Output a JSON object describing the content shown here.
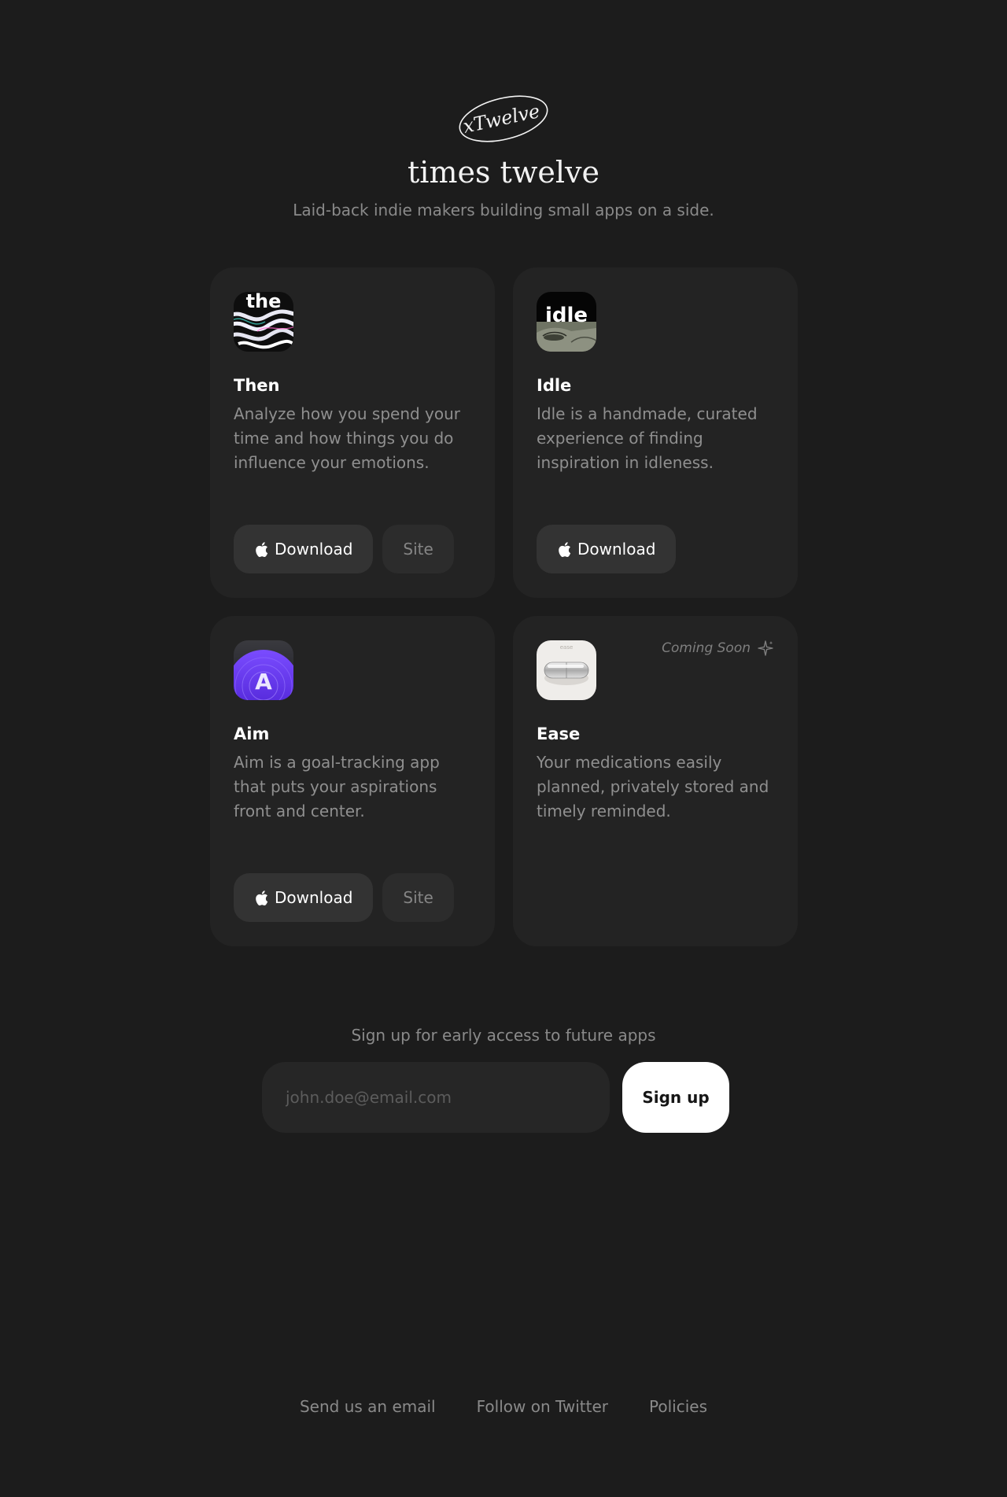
{
  "header": {
    "logo_text": "xTwelve",
    "title": "times twelve",
    "tagline": "Laid-back indie makers building small apps on a side."
  },
  "apps": [
    {
      "name": "Then",
      "icon": "then-app-icon",
      "icon_text": "the",
      "description": "Analyze how you spend your time and how things you do influence your emotions.",
      "download_label": "Download",
      "site_label": "Site"
    },
    {
      "name": "Idle",
      "icon": "idle-app-icon",
      "icon_text": "idle",
      "description": "Idle is a handmade, curated experience of finding inspiration in idleness.",
      "download_label": "Download"
    },
    {
      "name": "Aim",
      "icon": "aim-app-icon",
      "icon_text": "A",
      "description": "Aim is a goal-tracking app that puts your aspirations front and center.",
      "download_label": "Download",
      "site_label": "Site"
    },
    {
      "name": "Ease",
      "icon": "ease-app-icon",
      "icon_text": "ease",
      "description": "Your medications easily planned, privately stored and timely reminded.",
      "badge": "Coming Soon"
    }
  ],
  "signup": {
    "prompt": "Sign up for early access to future apps",
    "placeholder": "john.doe@email.com",
    "button_label": "Sign up"
  },
  "footer": {
    "links": [
      "Send us an email",
      "Follow on Twitter",
      "Policies"
    ]
  },
  "colors": {
    "background": "#1c1c1c",
    "card": "#232323",
    "button": "#333333",
    "muted_text": "#8a8a8a",
    "aim_purple": "#5a2ee6"
  }
}
